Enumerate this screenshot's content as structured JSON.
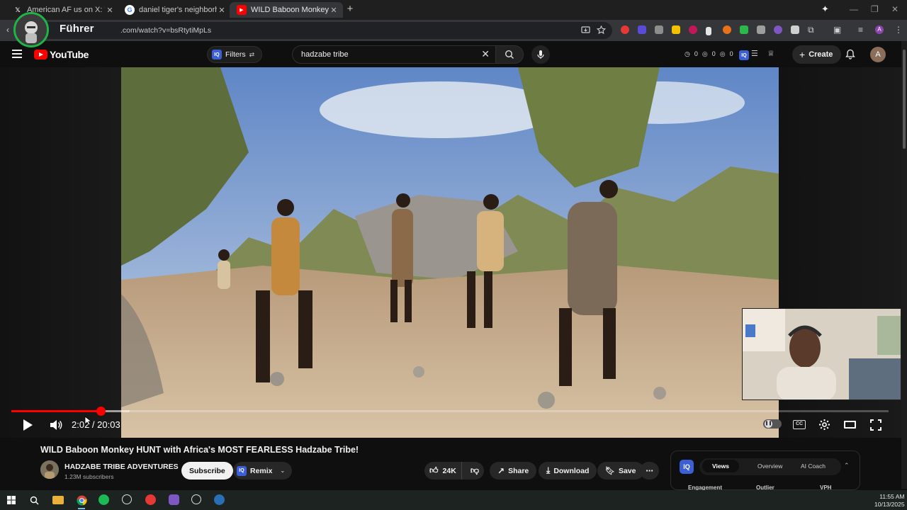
{
  "browser": {
    "tabs": [
      {
        "title": "American AF us on X: \"One of th",
        "favicon": "x-icon",
        "active": false
      },
      {
        "title": "daniel tiger's neighborhood - G",
        "favicon": "google-icon",
        "active": false
      },
      {
        "title": "WILD Baboon Monkey HUNT w",
        "favicon": "youtube-icon",
        "active": true
      }
    ],
    "url": ".com/watch?v=bsRtytiMpLs",
    "overlay_name": "Führer"
  },
  "youtube": {
    "logo_text": "YouTube",
    "filters_label": "Filters",
    "search_query": "hadzabe tribe",
    "stats": [
      "0",
      "0",
      "0"
    ],
    "create_label": "Create",
    "user_initial": "A"
  },
  "player": {
    "time_current": "2:02",
    "time_total": "20:03",
    "time_display": "2:02 / 20:03",
    "progress_fraction": 0.1015,
    "buffered_fraction": 0.135
  },
  "video": {
    "title": "WILD Baboon Monkey HUNT with Africa's MOST FEARLESS Hadzabe Tribe!",
    "channel_name": "HADZABE TRIBE ADVENTURES",
    "subscribers": "1.23M subscribers",
    "subscribe_label": "Subscribe",
    "remix_label": "Remix",
    "likes": "24K",
    "share_label": "Share",
    "download_label": "Download",
    "save_label": "Save"
  },
  "vidiq": {
    "tabs": [
      "Views",
      "Overview",
      "AI Coach"
    ],
    "active_tab": "Views",
    "columns": [
      "Engagement",
      "Outlier",
      "VPH"
    ]
  },
  "taskbar": {
    "time": "11:55 AM",
    "date": "10/13/2025"
  },
  "colors": {
    "accent_red": "#ff0000",
    "vidiq_blue": "#3c5fd6",
    "background": "#0f0f0f"
  }
}
